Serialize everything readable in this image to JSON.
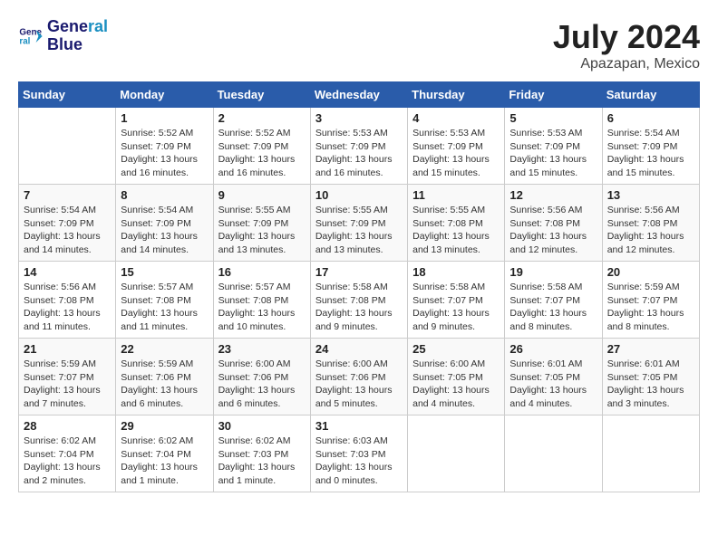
{
  "header": {
    "logo_line1": "General",
    "logo_line2": "Blue",
    "title": "July 2024",
    "subtitle": "Apazapan, Mexico"
  },
  "days_of_week": [
    "Sunday",
    "Monday",
    "Tuesday",
    "Wednesday",
    "Thursday",
    "Friday",
    "Saturday"
  ],
  "weeks": [
    [
      {
        "day": "",
        "info": ""
      },
      {
        "day": "1",
        "info": "Sunrise: 5:52 AM\nSunset: 7:09 PM\nDaylight: 13 hours\nand 16 minutes."
      },
      {
        "day": "2",
        "info": "Sunrise: 5:52 AM\nSunset: 7:09 PM\nDaylight: 13 hours\nand 16 minutes."
      },
      {
        "day": "3",
        "info": "Sunrise: 5:53 AM\nSunset: 7:09 PM\nDaylight: 13 hours\nand 16 minutes."
      },
      {
        "day": "4",
        "info": "Sunrise: 5:53 AM\nSunset: 7:09 PM\nDaylight: 13 hours\nand 15 minutes."
      },
      {
        "day": "5",
        "info": "Sunrise: 5:53 AM\nSunset: 7:09 PM\nDaylight: 13 hours\nand 15 minutes."
      },
      {
        "day": "6",
        "info": "Sunrise: 5:54 AM\nSunset: 7:09 PM\nDaylight: 13 hours\nand 15 minutes."
      }
    ],
    [
      {
        "day": "7",
        "info": "Sunrise: 5:54 AM\nSunset: 7:09 PM\nDaylight: 13 hours\nand 14 minutes."
      },
      {
        "day": "8",
        "info": "Sunrise: 5:54 AM\nSunset: 7:09 PM\nDaylight: 13 hours\nand 14 minutes."
      },
      {
        "day": "9",
        "info": "Sunrise: 5:55 AM\nSunset: 7:09 PM\nDaylight: 13 hours\nand 13 minutes."
      },
      {
        "day": "10",
        "info": "Sunrise: 5:55 AM\nSunset: 7:09 PM\nDaylight: 13 hours\nand 13 minutes."
      },
      {
        "day": "11",
        "info": "Sunrise: 5:55 AM\nSunset: 7:08 PM\nDaylight: 13 hours\nand 13 minutes."
      },
      {
        "day": "12",
        "info": "Sunrise: 5:56 AM\nSunset: 7:08 PM\nDaylight: 13 hours\nand 12 minutes."
      },
      {
        "day": "13",
        "info": "Sunrise: 5:56 AM\nSunset: 7:08 PM\nDaylight: 13 hours\nand 12 minutes."
      }
    ],
    [
      {
        "day": "14",
        "info": "Sunrise: 5:56 AM\nSunset: 7:08 PM\nDaylight: 13 hours\nand 11 minutes."
      },
      {
        "day": "15",
        "info": "Sunrise: 5:57 AM\nSunset: 7:08 PM\nDaylight: 13 hours\nand 11 minutes."
      },
      {
        "day": "16",
        "info": "Sunrise: 5:57 AM\nSunset: 7:08 PM\nDaylight: 13 hours\nand 10 minutes."
      },
      {
        "day": "17",
        "info": "Sunrise: 5:58 AM\nSunset: 7:08 PM\nDaylight: 13 hours\nand 9 minutes."
      },
      {
        "day": "18",
        "info": "Sunrise: 5:58 AM\nSunset: 7:07 PM\nDaylight: 13 hours\nand 9 minutes."
      },
      {
        "day": "19",
        "info": "Sunrise: 5:58 AM\nSunset: 7:07 PM\nDaylight: 13 hours\nand 8 minutes."
      },
      {
        "day": "20",
        "info": "Sunrise: 5:59 AM\nSunset: 7:07 PM\nDaylight: 13 hours\nand 8 minutes."
      }
    ],
    [
      {
        "day": "21",
        "info": "Sunrise: 5:59 AM\nSunset: 7:07 PM\nDaylight: 13 hours\nand 7 minutes."
      },
      {
        "day": "22",
        "info": "Sunrise: 5:59 AM\nSunset: 7:06 PM\nDaylight: 13 hours\nand 6 minutes."
      },
      {
        "day": "23",
        "info": "Sunrise: 6:00 AM\nSunset: 7:06 PM\nDaylight: 13 hours\nand 6 minutes."
      },
      {
        "day": "24",
        "info": "Sunrise: 6:00 AM\nSunset: 7:06 PM\nDaylight: 13 hours\nand 5 minutes."
      },
      {
        "day": "25",
        "info": "Sunrise: 6:00 AM\nSunset: 7:05 PM\nDaylight: 13 hours\nand 4 minutes."
      },
      {
        "day": "26",
        "info": "Sunrise: 6:01 AM\nSunset: 7:05 PM\nDaylight: 13 hours\nand 4 minutes."
      },
      {
        "day": "27",
        "info": "Sunrise: 6:01 AM\nSunset: 7:05 PM\nDaylight: 13 hours\nand 3 minutes."
      }
    ],
    [
      {
        "day": "28",
        "info": "Sunrise: 6:02 AM\nSunset: 7:04 PM\nDaylight: 13 hours\nand 2 minutes."
      },
      {
        "day": "29",
        "info": "Sunrise: 6:02 AM\nSunset: 7:04 PM\nDaylight: 13 hours\nand 1 minute."
      },
      {
        "day": "30",
        "info": "Sunrise: 6:02 AM\nSunset: 7:03 PM\nDaylight: 13 hours\nand 1 minute."
      },
      {
        "day": "31",
        "info": "Sunrise: 6:03 AM\nSunset: 7:03 PM\nDaylight: 13 hours\nand 0 minutes."
      },
      {
        "day": "",
        "info": ""
      },
      {
        "day": "",
        "info": ""
      },
      {
        "day": "",
        "info": ""
      }
    ]
  ]
}
